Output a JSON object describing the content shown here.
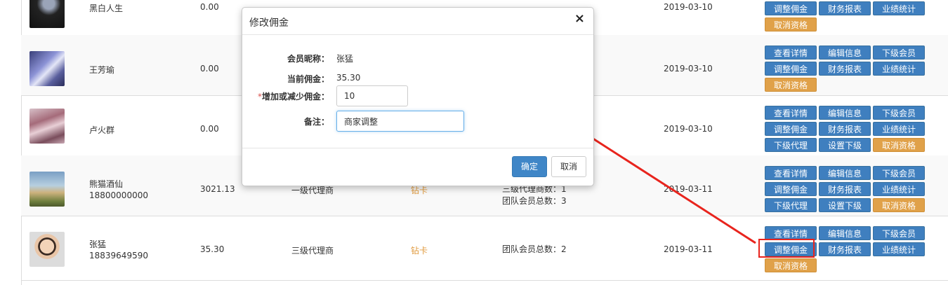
{
  "rows": [
    {
      "name": "黑白人生",
      "phone": "",
      "balance": "0.00",
      "level": "",
      "card": "",
      "team": [],
      "date": "2019-03-10",
      "actions": [
        {
          "label": "调整佣金",
          "style": "blue"
        },
        {
          "label": "财务报表",
          "style": "blue"
        },
        {
          "label": "业绩统计",
          "style": "blue"
        },
        {
          "label": "取消资格",
          "style": "orange"
        }
      ]
    },
    {
      "name": "王芳瑜",
      "phone": "",
      "balance": "0.00",
      "level": "",
      "card": "",
      "team": [],
      "date": "2019-03-10",
      "actions": [
        {
          "label": "查看详情",
          "style": "blue"
        },
        {
          "label": "编辑信息",
          "style": "blue"
        },
        {
          "label": "下级会员",
          "style": "blue"
        },
        {
          "label": "调整佣金",
          "style": "blue"
        },
        {
          "label": "财务报表",
          "style": "blue"
        },
        {
          "label": "业绩统计",
          "style": "blue"
        },
        {
          "label": "取消资格",
          "style": "orange"
        }
      ]
    },
    {
      "name": "卢火群",
      "phone": "",
      "balance": "0.00",
      "level": "",
      "card": "",
      "team": [],
      "date": "2019-03-10",
      "actions": [
        {
          "label": "查看详情",
          "style": "blue"
        },
        {
          "label": "编辑信息",
          "style": "blue"
        },
        {
          "label": "下级会员",
          "style": "blue"
        },
        {
          "label": "调整佣金",
          "style": "blue"
        },
        {
          "label": "财务报表",
          "style": "blue"
        },
        {
          "label": "业绩统计",
          "style": "blue"
        },
        {
          "label": "下级代理",
          "style": "blue"
        },
        {
          "label": "设置下级",
          "style": "blue"
        },
        {
          "label": "取消资格",
          "style": "orange"
        }
      ]
    },
    {
      "name": "熊猫酒仙",
      "phone": "18800000000",
      "balance": "3021.13",
      "level": "一级代理商",
      "card": "钻卡",
      "team": [
        "三级代理商数：1",
        "团队会员总数：3"
      ],
      "date": "2019-03-11",
      "actions": [
        {
          "label": "查看详情",
          "style": "blue"
        },
        {
          "label": "编辑信息",
          "style": "blue"
        },
        {
          "label": "下级会员",
          "style": "blue"
        },
        {
          "label": "调整佣金",
          "style": "blue"
        },
        {
          "label": "财务报表",
          "style": "blue"
        },
        {
          "label": "业绩统计",
          "style": "blue"
        },
        {
          "label": "下级代理",
          "style": "blue"
        },
        {
          "label": "设置下级",
          "style": "blue"
        },
        {
          "label": "取消资格",
          "style": "orange"
        }
      ]
    },
    {
      "name": "张猛",
      "phone": "18839649590",
      "balance": "35.30",
      "level": "三级代理商",
      "card": "钻卡",
      "team": [
        "团队会员总数：2"
      ],
      "date": "2019-03-11",
      "actions": [
        {
          "label": "查看详情",
          "style": "blue"
        },
        {
          "label": "编辑信息",
          "style": "blue"
        },
        {
          "label": "下级会员",
          "style": "blue"
        },
        {
          "label": "调整佣金",
          "style": "blue"
        },
        {
          "label": "财务报表",
          "style": "blue"
        },
        {
          "label": "业绩统计",
          "style": "blue"
        },
        {
          "label": "取消资格",
          "style": "orange"
        }
      ]
    }
  ],
  "modal": {
    "title": "修改佣金",
    "close_icon": "×",
    "nickname_label": "会员昵称：",
    "nickname_value": "张猛",
    "current_label": "当前佣金：",
    "current_value": "35.30",
    "required_mark": "*",
    "adjust_label": "增加或减少佣金：",
    "adjust_value": "10",
    "remark_label": "备注：",
    "remark_value": "商家调整",
    "ok_label": "确定",
    "cancel_label": "取消"
  },
  "colors": {
    "button_blue": "#3f7fbf",
    "button_orange": "#e0a149",
    "card_text": "#e09a3d",
    "annotation_red": "#e8241d"
  }
}
